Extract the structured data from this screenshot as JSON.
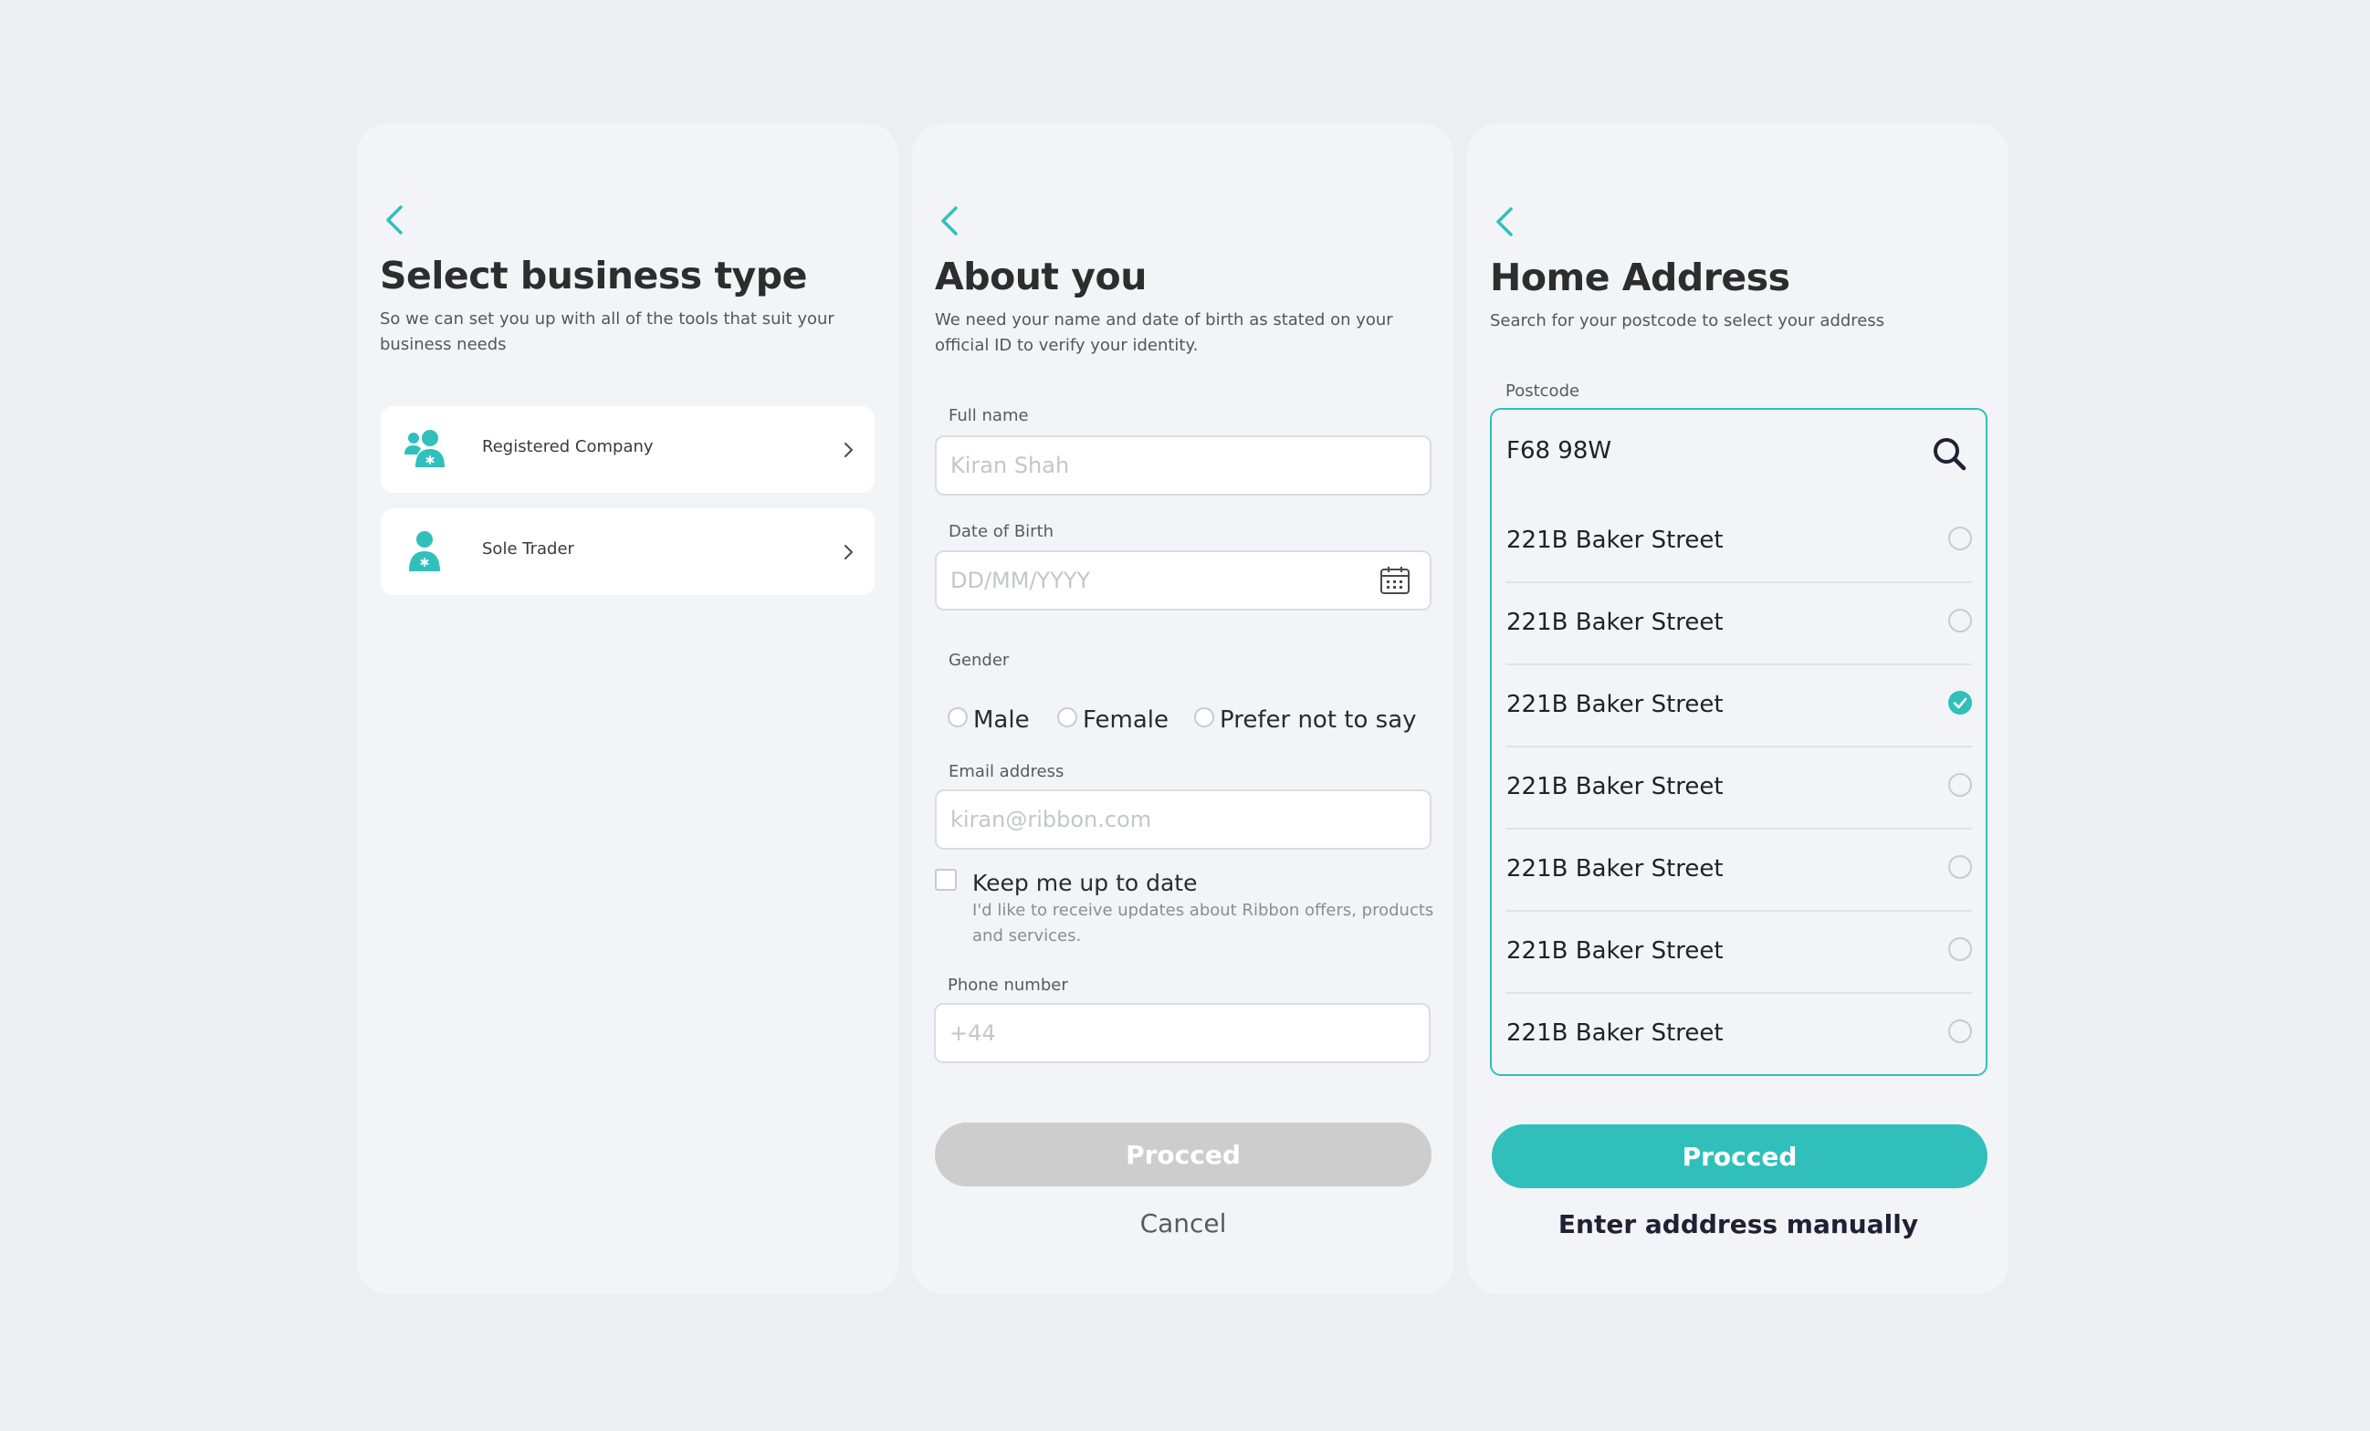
{
  "colors": {
    "accent": "#31bfbc",
    "background": "#eceff2",
    "card": "#f2f4f7",
    "disabled": "#cdcdcd"
  },
  "business": {
    "back_icon": "chevron-left-icon",
    "title": "Select business type",
    "subtitle": "So we can set you up with all of the tools that suit your business needs",
    "options": [
      {
        "label": "Registered Company",
        "icon": "group-icon"
      },
      {
        "label": "Sole Trader",
        "icon": "person-icon"
      }
    ]
  },
  "about": {
    "back_icon": "chevron-left-icon",
    "title": "About you",
    "subtitle": "We need your name and date of birth as stated on your official ID to verify your identity.",
    "full_name": {
      "label": "Full name",
      "placeholder": "Kiran Shah"
    },
    "dob": {
      "label": "Date of Birth",
      "placeholder": "DD/MM/YYYY",
      "icon": "calendar-icon"
    },
    "gender": {
      "label": "Gender",
      "options": [
        "Male",
        "Female",
        "Prefer not to say"
      ]
    },
    "email": {
      "label": "Email address",
      "placeholder": "kiran@ribbon.com"
    },
    "updates": {
      "title": "Keep me up to date",
      "description": "I'd like to receive updates about Ribbon offers, products and services.",
      "checked": false
    },
    "phone": {
      "label": "Phone number",
      "placeholder": "+44"
    },
    "proceed_label": "Procced",
    "cancel_label": "Cancel"
  },
  "address": {
    "back_icon": "chevron-left-icon",
    "title": "Home Address",
    "subtitle": "Search for your postcode to select your address",
    "postcode_label": "Postcode",
    "postcode_value": "F68 98W",
    "search_icon": "search-icon",
    "items": [
      {
        "text": "221B Baker Street",
        "selected": false
      },
      {
        "text": "221B Baker Street",
        "selected": false
      },
      {
        "text": "221B Baker Street",
        "selected": true
      },
      {
        "text": "221B Baker Street",
        "selected": false
      },
      {
        "text": "221B Baker Street",
        "selected": false
      },
      {
        "text": "221B Baker Street",
        "selected": false
      },
      {
        "text": "221B Baker Street",
        "selected": false
      }
    ],
    "proceed_label": "Procced",
    "manual_label": "Enter adddress manually"
  }
}
